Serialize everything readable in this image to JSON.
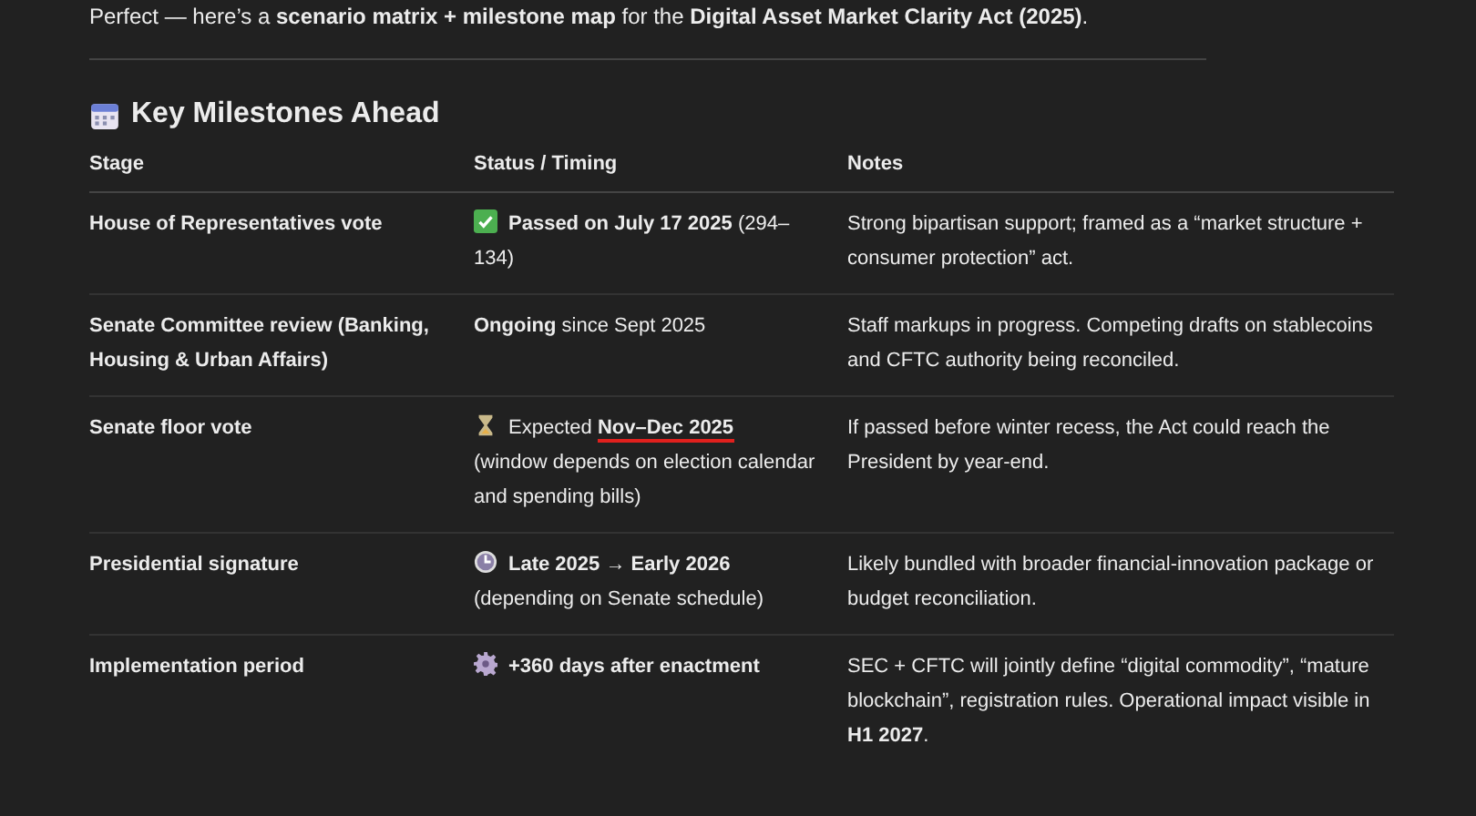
{
  "intro": "Perfect — here’s a **scenario matrix + milestone map** for the **Digital Asset Market Clarity Act (2025)**.",
  "section": {
    "title": "Key Milestones Ahead"
  },
  "table": {
    "columns": [
      "Stage",
      "Status / Timing",
      "Notes"
    ],
    "rows": [
      {
        "stage": "House of Representatives vote",
        "status": {
          "kind": "check",
          "lines": [
            [
              {
                "text": "**Passed on July 17 2025** (294–134)",
                "underlined": false
              }
            ]
          ]
        },
        "notes": "Strong bipartisan support; framed as a “market structure + consumer protection” act."
      },
      {
        "stage": "Senate Committee review (Banking, Housing & Urban Affairs)",
        "status": {
          "kind": "plain",
          "lines": [
            [
              {
                "text": "**Ongoing** since Sept 2025",
                "underlined": false
              }
            ]
          ]
        },
        "notes": "Staff markups in progress. Competing drafts on stablecoins and CFTC authority being reconciled."
      },
      {
        "stage": "Senate floor vote",
        "status": {
          "kind": "hourglass",
          "lines": [
            [
              {
                "text": "Expected",
                "underlined": false
              },
              {
                "text": "**Nov–Dec 2025**",
                "underlined": true
              }
            ],
            [
              {
                "text": "(window depends on election calendar and spending bills)",
                "underlined": false
              }
            ]
          ]
        },
        "notes": "If passed before winter recess, the Act could reach the President by year-end."
      },
      {
        "stage": "Presidential signature",
        "status": {
          "kind": "clock",
          "lines": [
            [
              {
                "text": "**Late 2025 → Early 2026**",
                "underlined": false
              }
            ],
            [
              {
                "text": "(depending on Senate schedule)",
                "underlined": false
              }
            ]
          ]
        },
        "notes": "Likely bundled with broader financial-innovation package or budget reconciliation."
      },
      {
        "stage": "Implementation period",
        "status": {
          "kind": "gear",
          "lines": [
            [
              {
                "text": "**+360 days after enactment**",
                "underlined": false
              }
            ]
          ]
        },
        "notes": "SEC + CFTC will jointly define “digital commodity”, “mature blockchain”, registration rules. Operational impact visible in **H1 2027**."
      }
    ]
  }
}
